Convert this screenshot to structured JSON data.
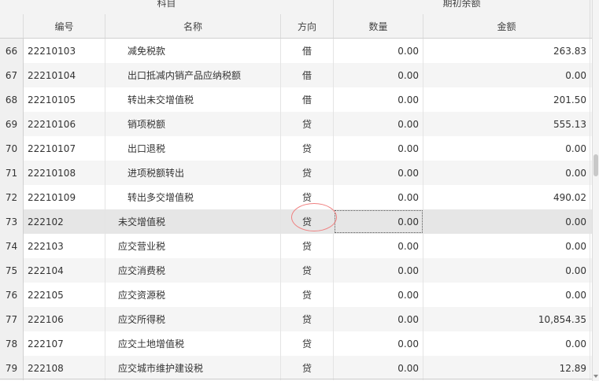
{
  "header": {
    "group_subject": "科目",
    "group_opening": "期初余额",
    "col_code": "编号",
    "col_name": "名称",
    "col_direction": "方向",
    "col_quantity": "数量",
    "col_amount": "金额"
  },
  "rows": [
    {
      "num": "66",
      "code": "22210103",
      "name": "减免税款",
      "dir": "借",
      "qty": "0.00",
      "amt": "263.83"
    },
    {
      "num": "67",
      "code": "22210104",
      "name": "出口抵减内销产品应纳税额",
      "dir": "借",
      "qty": "0.00",
      "amt": "0.00"
    },
    {
      "num": "68",
      "code": "22210105",
      "name": "转出未交增值税",
      "dir": "借",
      "qty": "0.00",
      "amt": "201.50"
    },
    {
      "num": "69",
      "code": "22210106",
      "name": "销项税额",
      "dir": "贷",
      "qty": "0.00",
      "amt": "555.13"
    },
    {
      "num": "70",
      "code": "22210107",
      "name": "出口退税",
      "dir": "贷",
      "qty": "0.00",
      "amt": "0.00"
    },
    {
      "num": "71",
      "code": "22210108",
      "name": "进项税额转出",
      "dir": "贷",
      "qty": "0.00",
      "amt": "0.00"
    },
    {
      "num": "72",
      "code": "22210109",
      "name": "转出多交增值税",
      "dir": "贷",
      "qty": "0.00",
      "amt": "490.02"
    },
    {
      "num": "73",
      "code": "222102",
      "name": "未交增值税",
      "dir": "贷",
      "qty": "0.00",
      "amt": "0.00"
    },
    {
      "num": "74",
      "code": "222103",
      "name": "应交营业税",
      "dir": "贷",
      "qty": "0.00",
      "amt": "0.00"
    },
    {
      "num": "75",
      "code": "222104",
      "name": "应交消费税",
      "dir": "贷",
      "qty": "0.00",
      "amt": "0.00"
    },
    {
      "num": "76",
      "code": "222105",
      "name": "应交资源税",
      "dir": "贷",
      "qty": "0.00",
      "amt": "0.00"
    },
    {
      "num": "77",
      "code": "222106",
      "name": "应交所得税",
      "dir": "贷",
      "qty": "0.00",
      "amt": "10,854.35"
    },
    {
      "num": "78",
      "code": "222107",
      "name": "应交土地增值税",
      "dir": "贷",
      "qty": "0.00",
      "amt": "0.00"
    },
    {
      "num": "79",
      "code": "222108",
      "name": "应交城市维护建设税",
      "dir": "贷",
      "qty": "0.00",
      "amt": "12.89"
    }
  ]
}
